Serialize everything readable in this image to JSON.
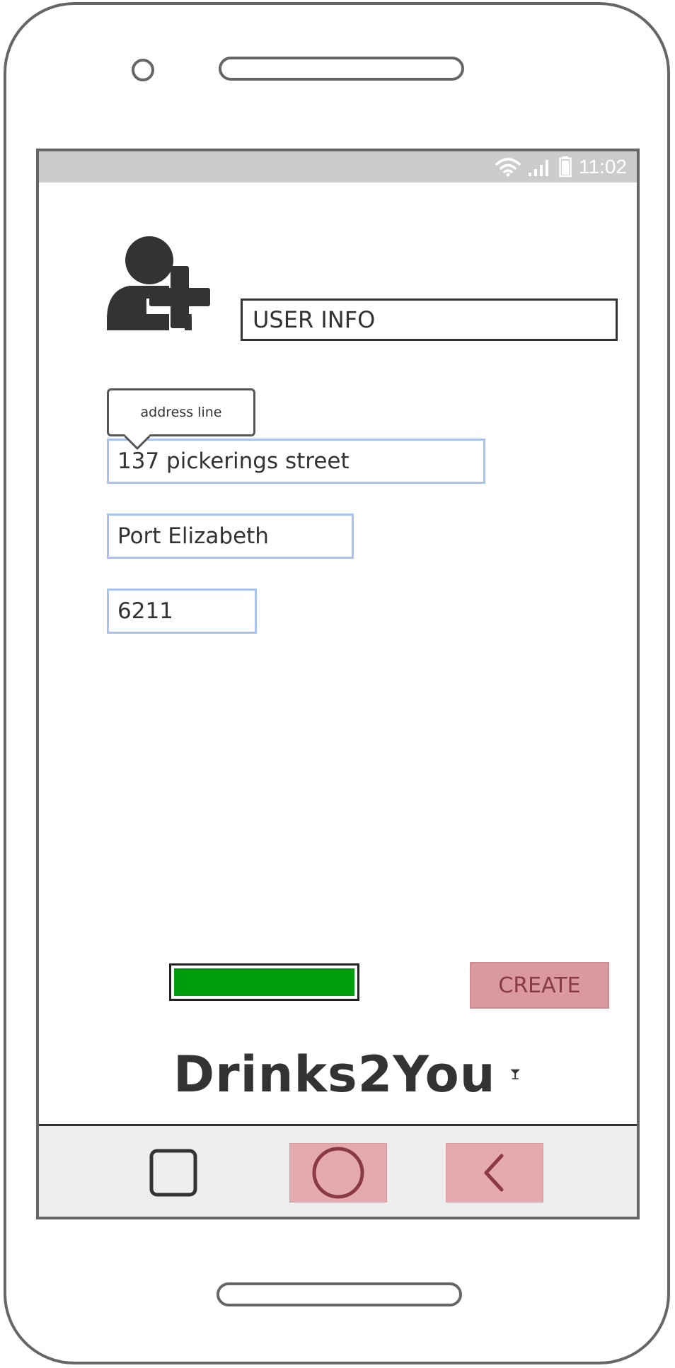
{
  "status_bar": {
    "time": "11:02",
    "icons": [
      "wifi-icon",
      "signal-icon",
      "battery-icon"
    ]
  },
  "header": {
    "icon": "user-add-icon",
    "title": "USER INFO"
  },
  "form": {
    "tooltip": "address line",
    "address": "137 pickerings street",
    "city": "Port Elizabeth",
    "postal_code": "6211"
  },
  "progress": {
    "value": 1.0,
    "color": "#009e0f"
  },
  "actions": {
    "create_label": "CREATE"
  },
  "brand": {
    "name": "Drinks2You",
    "icon": "cocktail-glass-icon"
  },
  "nav": {
    "items": [
      "recent-apps-icon",
      "home-icon",
      "back-icon"
    ]
  },
  "colors": {
    "accent_button": "#d9999f",
    "input_border": "#a8c4ee",
    "frame": "#666666"
  }
}
